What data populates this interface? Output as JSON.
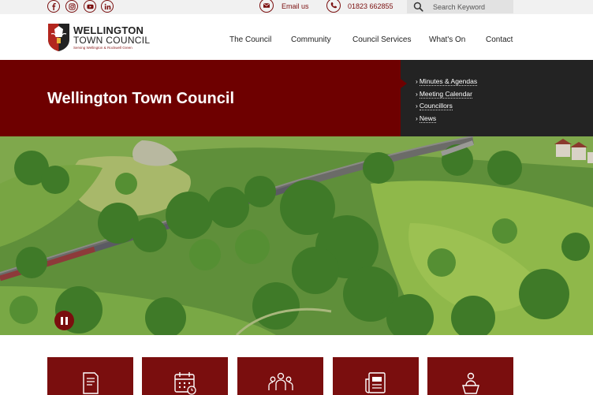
{
  "top_bar": {
    "social_icons": [
      "facebook-icon",
      "instagram-icon",
      "youtube-icon",
      "linkedin-icon"
    ],
    "email_label": "Email us",
    "phone_label": "01823 662855",
    "search_placeholder": "Search Keyword"
  },
  "header": {
    "logo_line1": "WELLINGTON",
    "logo_line2": "TOWN COUNCIL",
    "logo_tagline": "Serving Wellington & Rockwell Green",
    "nav": [
      "The Council",
      "Community",
      "Council Services",
      "What's On",
      "Contact"
    ]
  },
  "banner": {
    "title": "Wellington Town Council",
    "quick_links": [
      "Minutes & Agendas",
      "Meeting Calendar",
      "Councillors",
      "News"
    ]
  },
  "hero": {
    "image": "aerial-view-wellington-countryside-train",
    "pause_icon": "pause-icon"
  },
  "service_tiles": [
    "document-icon",
    "calendar-icon",
    "people-icon",
    "newspaper-icon",
    "speaker-podium-icon"
  ],
  "colors": {
    "brand_red": "#7a0e0e",
    "banner_red": "#6e0000",
    "dark_panel": "#232323",
    "top_bar_bg": "#f1f1f1"
  }
}
